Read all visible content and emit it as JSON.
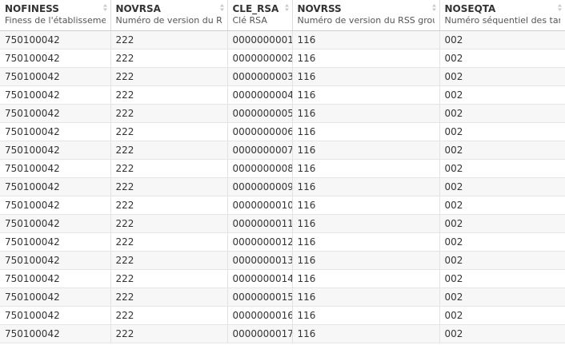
{
  "columns": [
    {
      "name": "NOFINESS",
      "description": "Finess de l'établissement"
    },
    {
      "name": "NOVRSA",
      "description": "Numéro de version du RSA"
    },
    {
      "name": "CLE_RSA",
      "description": "Clé RSA"
    },
    {
      "name": "NOVRSS",
      "description": "Numéro de version du RSS groupé"
    },
    {
      "name": "NOSEQTA",
      "description": "Numéro séquentiel des tarifs"
    }
  ],
  "rows": [
    [
      "750100042",
      "222",
      "0000000001",
      "116",
      "002"
    ],
    [
      "750100042",
      "222",
      "0000000002",
      "116",
      "002"
    ],
    [
      "750100042",
      "222",
      "0000000003",
      "116",
      "002"
    ],
    [
      "750100042",
      "222",
      "0000000004",
      "116",
      "002"
    ],
    [
      "750100042",
      "222",
      "0000000005",
      "116",
      "002"
    ],
    [
      "750100042",
      "222",
      "0000000006",
      "116",
      "002"
    ],
    [
      "750100042",
      "222",
      "0000000007",
      "116",
      "002"
    ],
    [
      "750100042",
      "222",
      "0000000008",
      "116",
      "002"
    ],
    [
      "750100042",
      "222",
      "0000000009",
      "116",
      "002"
    ],
    [
      "750100042",
      "222",
      "0000000010",
      "116",
      "002"
    ],
    [
      "750100042",
      "222",
      "0000000011",
      "116",
      "002"
    ],
    [
      "750100042",
      "222",
      "0000000012",
      "116",
      "002"
    ],
    [
      "750100042",
      "222",
      "0000000013",
      "116",
      "002"
    ],
    [
      "750100042",
      "222",
      "0000000014",
      "116",
      "002"
    ],
    [
      "750100042",
      "222",
      "0000000015",
      "116",
      "002"
    ],
    [
      "750100042",
      "222",
      "0000000016",
      "116",
      "002"
    ],
    [
      "750100042",
      "222",
      "0000000017",
      "116",
      "002"
    ]
  ],
  "icons": {
    "sort": "sort-icon"
  },
  "colors": {
    "stripe": "#f7f7f7",
    "text": "#333333",
    "border": "#e2e2e2"
  }
}
